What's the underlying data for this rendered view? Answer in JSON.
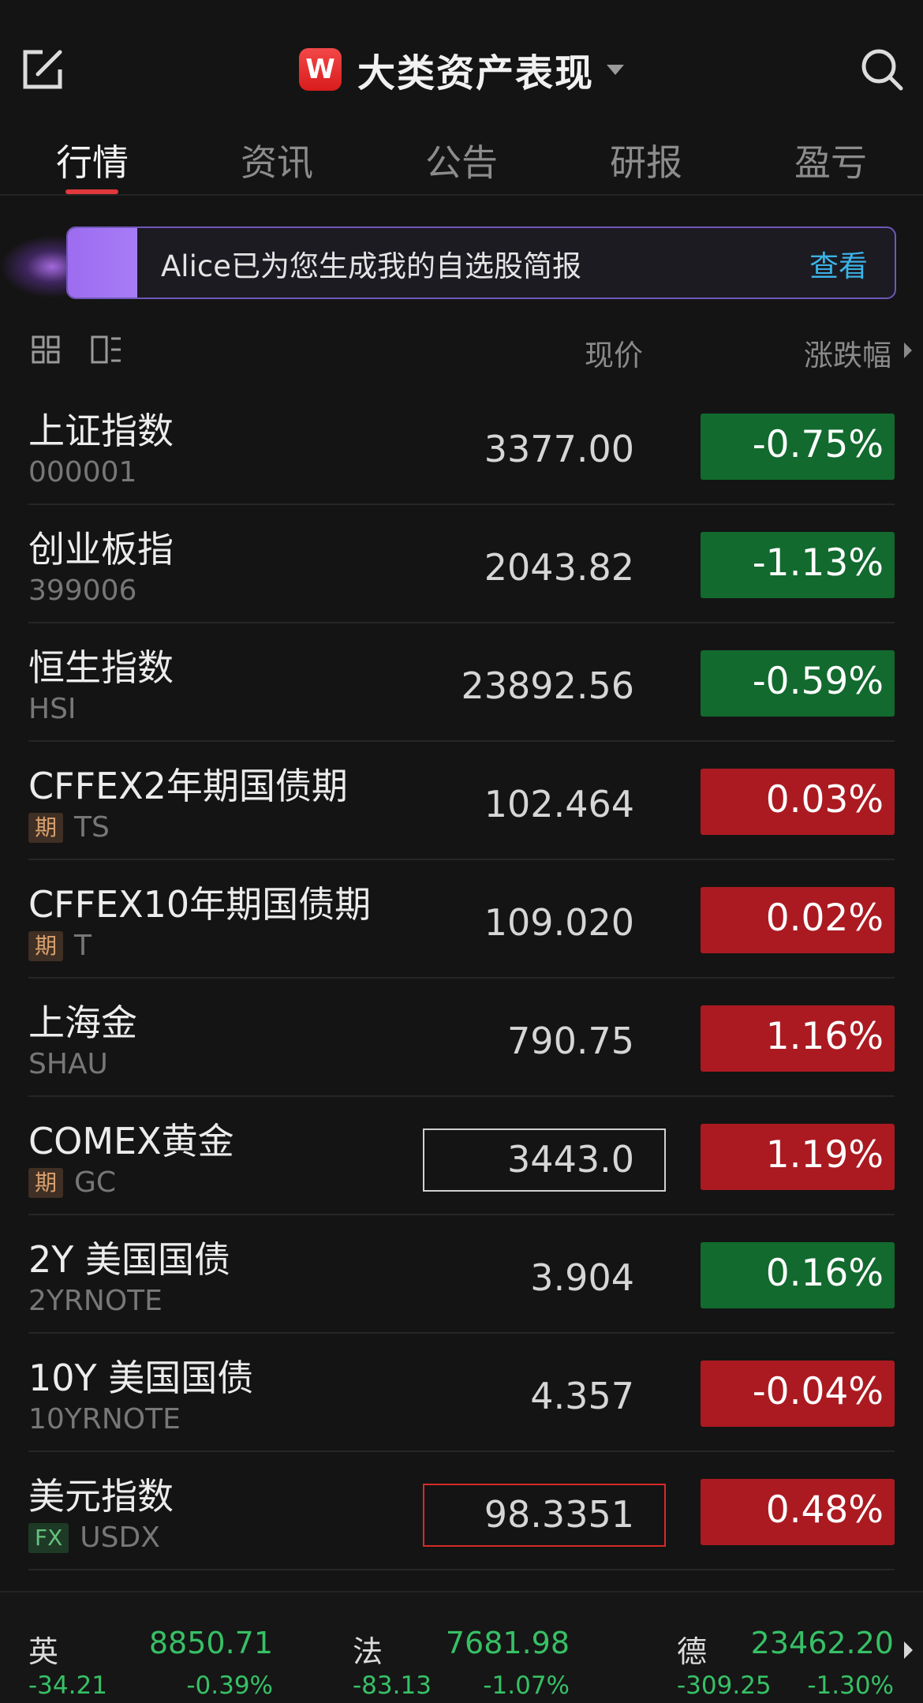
{
  "header": {
    "logo_text": "W",
    "title": "大类资产表现"
  },
  "tabs": [
    {
      "label": "行情",
      "active": true
    },
    {
      "label": "资讯",
      "active": false
    },
    {
      "label": "公告",
      "active": false
    },
    {
      "label": "研报",
      "active": false
    },
    {
      "label": "盈亏",
      "active": false
    }
  ],
  "banner": {
    "text": "Alice已为您生成我的自选股简报",
    "link": "查看"
  },
  "list_header": {
    "price_col": "现价",
    "change_col": "涨跌幅"
  },
  "colors": {
    "up": "#ab1a21",
    "down": "#126a2e",
    "accent": "#e0383c",
    "link": "#3bb2e6"
  },
  "rows": [
    {
      "name": "上证指数",
      "code": "000001",
      "tag": "",
      "price": "3377.00",
      "change": "-0.75%",
      "dir": "down",
      "box": ""
    },
    {
      "name": "创业板指",
      "code": "399006",
      "tag": "",
      "price": "2043.82",
      "change": "-1.13%",
      "dir": "down",
      "box": ""
    },
    {
      "name": "恒生指数",
      "code": "HSI",
      "tag": "",
      "price": "23892.56",
      "change": "-0.59%",
      "dir": "down",
      "box": ""
    },
    {
      "name": "CFFEX2年期国债期",
      "code": "TS",
      "tag": "期",
      "price": "102.464",
      "change": "0.03%",
      "dir": "up",
      "box": ""
    },
    {
      "name": "CFFEX10年期国债期",
      "code": "T",
      "tag": "期",
      "price": "109.020",
      "change": "0.02%",
      "dir": "up",
      "box": ""
    },
    {
      "name": "上海金",
      "code": "SHAU",
      "tag": "",
      "price": "790.75",
      "change": "1.16%",
      "dir": "up",
      "box": ""
    },
    {
      "name": "COMEX黄金",
      "code": "GC",
      "tag": "期",
      "price": "3443.0",
      "change": "1.19%",
      "dir": "up",
      "box": "white"
    },
    {
      "name": "2Y 美国国债",
      "code": "2YRNOTE",
      "tag": "",
      "price": "3.904",
      "change": "0.16%",
      "dir": "down",
      "box": ""
    },
    {
      "name": "10Y 美国国债",
      "code": "10YRNOTE",
      "tag": "",
      "price": "4.357",
      "change": "-0.04%",
      "dir": "up",
      "box": ""
    },
    {
      "name": "美元指数",
      "code": "USDX",
      "tag": "FX",
      "price": "98.3351",
      "change": "0.48%",
      "dir": "up",
      "box": "red"
    }
  ],
  "ticker": [
    {
      "name": "英",
      "price": "8850.71",
      "change": "-34.21",
      "pct": "-0.39%"
    },
    {
      "name": "法",
      "price": "7681.98",
      "change": "-83.13",
      "pct": "-1.07%"
    },
    {
      "name": "德",
      "price": "23462.20",
      "change": "-309.25",
      "pct": "-1.30%"
    }
  ]
}
